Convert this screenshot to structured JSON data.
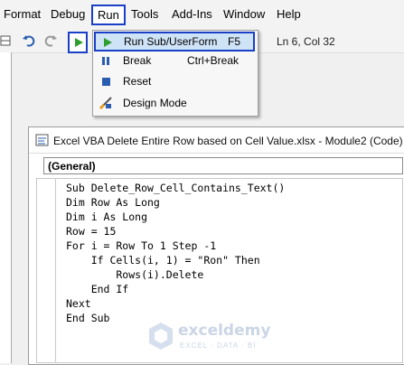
{
  "menubar": {
    "items": [
      "Format",
      "Debug",
      "Run",
      "Tools",
      "Add-Ins",
      "Window",
      "Help"
    ]
  },
  "toolbar": {
    "status": "Ln 6, Col 32"
  },
  "run_menu": {
    "items": [
      {
        "label": "Run Sub/UserForm",
        "shortcut": "F5",
        "icon": "play-icon"
      },
      {
        "label": "Break",
        "shortcut": "Ctrl+Break",
        "icon": "pause-icon"
      },
      {
        "label": "Reset",
        "shortcut": "",
        "icon": "stop-icon"
      },
      {
        "label": "Design Mode",
        "shortcut": "",
        "icon": "design-mode-icon"
      }
    ]
  },
  "code_window": {
    "title": "Excel VBA Delete Entire Row based on Cell Value.xlsx - Module2 (Code)",
    "object_dropdown": "(General)",
    "lines": [
      "Sub Delete_Row_Cell_Contains_Text()",
      "Dim Row As Long",
      "Dim i As Long",
      "Row = 15",
      "For i = Row To 1 Step -1",
      "    If Cells(i, 1) = \"Ron\" Then",
      "        Rows(i).Delete",
      "    End If",
      "Next",
      "End Sub"
    ]
  },
  "watermark": {
    "name": "exceldemy",
    "tagline": "EXCEL · DATA · BI"
  },
  "colors": {
    "highlight_border": "#1a3fc7",
    "menu_highlight": "#cfe3f7"
  }
}
